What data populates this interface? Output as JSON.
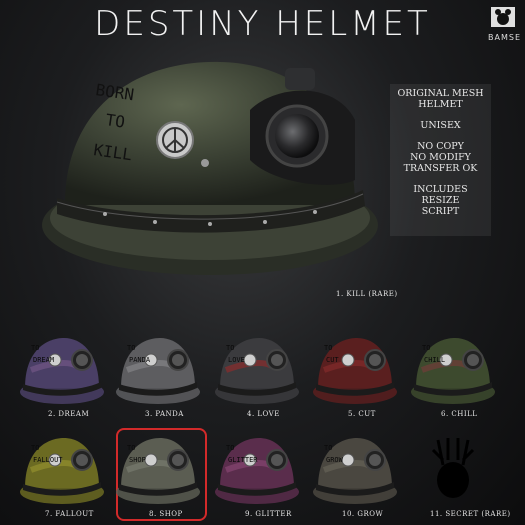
{
  "title": "DESTINY HELMET",
  "brand": "BAMSE",
  "hero": {
    "caption": "1. KILL (RARE)",
    "text_lines": [
      "BORN",
      "TO",
      "KILL"
    ]
  },
  "info": {
    "blocks": [
      [
        "ORIGINAL MESH",
        "HELMET"
      ],
      [
        "UNISEX"
      ],
      [
        "NO COPY",
        "NO MODIFY",
        "TRANSFER OK"
      ],
      [
        "INCLUDES",
        "RESIZE",
        "SCRIPT"
      ]
    ]
  },
  "variants": [
    {
      "label": "2. DREAM",
      "color": "#4a3f66",
      "accent": "#7a5a8a",
      "text": [
        "TO",
        "DREAM"
      ]
    },
    {
      "label": "3. PANDA",
      "color": "#5d5d60",
      "accent": "#8a8a8d",
      "text": [
        "TO",
        "PANDA"
      ]
    },
    {
      "label": "4. LOVE",
      "color": "#3b3b3e",
      "accent": "#9a2a2a",
      "text": [
        "TO",
        "LOVE"
      ]
    },
    {
      "label": "5. CUT",
      "color": "#5a1f1f",
      "accent": "#8a2d2d",
      "text": [
        "TO",
        "CUT"
      ]
    },
    {
      "label": "6. CHILL",
      "color": "#3d4a2e",
      "accent": "#7a3a3a",
      "text": [
        "TO",
        "CHILL"
      ]
    },
    {
      "label": "7. FALLOUT",
      "color": "#6b6a22",
      "accent": "#9a9630",
      "text": [
        "TO",
        "FALLOUT"
      ]
    },
    {
      "label": "8. SHOP",
      "color": "#5b5d52",
      "accent": "#7d8074",
      "text": [
        "TO",
        "SHOP"
      ]
    },
    {
      "label": "9. GLITTER",
      "color": "#5a2d4c",
      "accent": "#8e4a78",
      "text": [
        "TO",
        "GLITTER"
      ]
    },
    {
      "label": "10. GROW",
      "color": "#4a4740",
      "accent": "#6b675c",
      "text": [
        "TO",
        "GROW"
      ]
    },
    {
      "label": "11. SECRET (RARE)",
      "color": "#000000",
      "accent": "#000000",
      "text": []
    }
  ]
}
